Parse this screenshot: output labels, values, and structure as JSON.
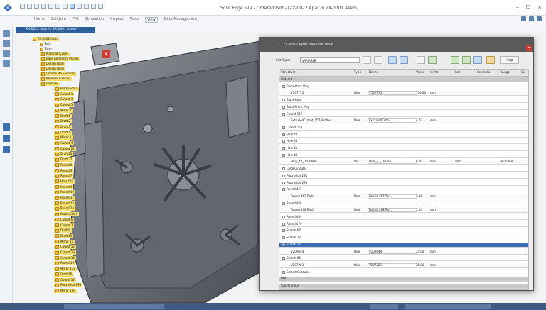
{
  "app": {
    "title": "Solid Edge ST9 - Ordered Part - [ZX-0022 Apar in ZX-0001 Asem]",
    "window_controls": [
      "–",
      "☐",
      "×"
    ]
  },
  "ribbon": {
    "tabs": [
      "Home",
      "Solidsim",
      "PMI",
      "Simulation",
      "Inspect",
      "Tools",
      "View",
      "Data Management"
    ],
    "selected_tab": "View"
  },
  "document_tab": {
    "label": "ZX-0022 Apar in ZX-0001 Asem *"
  },
  "pathfinder": {
    "items": [
      {
        "label": "ZX-0022 Apar1",
        "kind": "top"
      },
      {
        "label": "Sets",
        "kind": "node"
      },
      {
        "label": "Base",
        "kind": "node"
      },
      {
        "label": "Material (Cube)",
        "kind": "feat"
      },
      {
        "label": "Base Reference Planes",
        "kind": "feat"
      },
      {
        "label": "Design Body",
        "kind": "feat"
      },
      {
        "label": "Design Body",
        "kind": "feat"
      },
      {
        "label": "Coordinate Systems",
        "kind": "feat"
      },
      {
        "label": "Reference Planes",
        "kind": "feat"
      },
      {
        "label": "Features",
        "kind": "feat"
      },
      {
        "label": "Protrusion 1",
        "kind": "feat"
      },
      {
        "label": "Cutout 1",
        "kind": "feat"
      },
      {
        "label": "Cutout 2",
        "kind": "feat"
      },
      {
        "label": "Cutout 3",
        "kind": "feat"
      },
      {
        "label": "Mirror 1",
        "kind": "feat"
      },
      {
        "label": "Draft 1",
        "kind": "feat"
      },
      {
        "label": "Draft 2",
        "kind": "feat"
      },
      {
        "label": "Draft 3",
        "kind": "feat"
      },
      {
        "label": "Draft 4",
        "kind": "feat"
      },
      {
        "label": "Mirror 2",
        "kind": "feat"
      },
      {
        "label": "Cutout 4",
        "kind": "feat"
      },
      {
        "label": "Cutout 21",
        "kind": "feat"
      },
      {
        "label": "Draft 26",
        "kind": "feat"
      },
      {
        "label": "Draft 27",
        "kind": "feat"
      },
      {
        "label": "Round 6",
        "kind": "feat"
      },
      {
        "label": "Round 6",
        "kind": "feat"
      },
      {
        "label": "Round 7",
        "kind": "feat"
      },
      {
        "label": "Hole 403",
        "kind": "feat"
      },
      {
        "label": "Round 9",
        "kind": "feat"
      },
      {
        "label": "Round 10",
        "kind": "feat"
      },
      {
        "label": "Round 11",
        "kind": "feat"
      },
      {
        "label": "Round 12",
        "kind": "feat"
      },
      {
        "label": "Round 13",
        "kind": "feat"
      },
      {
        "label": "Protrusion 4",
        "kind": "feat"
      },
      {
        "label": "Cutout 6",
        "kind": "feat"
      },
      {
        "label": "Cutout 7",
        "kind": "feat"
      },
      {
        "label": "Draft 9",
        "kind": "feat"
      },
      {
        "label": "Draft 10",
        "kind": "feat"
      },
      {
        "label": "Mirror 11",
        "kind": "feat"
      },
      {
        "label": "Cutout 12",
        "kind": "feat"
      },
      {
        "label": "Cutout 13",
        "kind": "feat"
      },
      {
        "label": "Cutout 14",
        "kind": "feat"
      },
      {
        "label": "Round 15",
        "kind": "feat"
      },
      {
        "label": "Mirror 135",
        "kind": "feat"
      },
      {
        "label": "Draft 16",
        "kind": "feat"
      },
      {
        "label": "Cutout 17",
        "kind": "feat"
      },
      {
        "label": "Protrusion 194",
        "kind": "feat"
      },
      {
        "label": "Mirror 110",
        "kind": "feat"
      }
    ]
  },
  "variable_table": {
    "title": "ZX-0022 Apar Variable Table",
    "close_glyph": "×",
    "filter_label": "Edit Types",
    "filter_value": "VARIABLE",
    "help_label": "Help",
    "columns": [
      "Structure",
      "Type",
      "Name",
      "Value",
      "Units",
      "Rule",
      "Formula",
      "Range",
      "Ex"
    ],
    "rows": [
      {
        "kind": "sec",
        "structure": "Ordered",
        "type": "",
        "name": "",
        "value": "",
        "units": "",
        "rule": "",
        "range": ""
      },
      {
        "kind": "node",
        "structure": "Block-Back Plug",
        "type": "",
        "name": "",
        "value": "",
        "units": "",
        "rule": "",
        "range": ""
      },
      {
        "kind": "var",
        "structure": "V167775",
        "type": "Dim",
        "name": "V167775",
        "value": "130.00",
        "units": "mm",
        "rule": "",
        "range": ""
      },
      {
        "kind": "node",
        "structure": "Block-Reat",
        "type": "",
        "name": "",
        "value": "",
        "units": "",
        "rule": "",
        "range": ""
      },
      {
        "kind": "node",
        "structure": "Block-Front Plug",
        "type": "",
        "name": "",
        "value": "",
        "units": "",
        "rule": "",
        "range": ""
      },
      {
        "kind": "node",
        "structure": "Cutout 157",
        "type": "",
        "name": "",
        "value": "",
        "units": "",
        "rule": "",
        "range": ""
      },
      {
        "kind": "var",
        "structure": "ExtrudedCutout_157_Profile...",
        "type": "Dim",
        "name": "ExtrudedCutou...",
        "value": "4.42",
        "units": "mm",
        "rule": "",
        "range": ""
      },
      {
        "kind": "node",
        "structure": "Cutout 150",
        "type": "",
        "name": "",
        "value": "",
        "units": "",
        "rule": "",
        "range": ""
      },
      {
        "kind": "node",
        "structure": "Hole 44",
        "type": "",
        "name": "",
        "value": "",
        "units": "",
        "rule": "",
        "range": ""
      },
      {
        "kind": "node",
        "structure": "Hole 41",
        "type": "",
        "name": "",
        "value": "",
        "units": "",
        "rule": "",
        "range": ""
      },
      {
        "kind": "node",
        "structure": "Hole 45",
        "type": "",
        "name": "",
        "value": "",
        "units": "",
        "rule": "",
        "range": ""
      },
      {
        "kind": "node",
        "structure": "Hole 43",
        "type": "",
        "name": "",
        "value": "",
        "units": "",
        "rule": "",
        "range": ""
      },
      {
        "kind": "var",
        "structure": "Hole_43_Diameter",
        "type": "Var",
        "name": "Hole_43_Diame...",
        "value": "6.00",
        "units": "mm",
        "rule": "Limit",
        "range": "[6.00 mm..."
      },
      {
        "kind": "node",
        "structure": "LargeCutouts",
        "type": "",
        "name": "",
        "value": "",
        "units": "",
        "rule": "",
        "range": ""
      },
      {
        "kind": "node",
        "structure": "Protrusion 294",
        "type": "",
        "name": "",
        "value": "",
        "units": "",
        "rule": "",
        "range": ""
      },
      {
        "kind": "node",
        "structure": "Protrusion 296",
        "type": "",
        "name": "",
        "value": "",
        "units": "",
        "rule": "",
        "range": ""
      },
      {
        "kind": "node",
        "structure": "Round 467",
        "type": "",
        "name": "",
        "value": "",
        "units": "",
        "rule": "",
        "range": ""
      },
      {
        "kind": "var",
        "structure": "Round 467 Radii",
        "type": "Dim",
        "name": "Round 467 Ra...",
        "value": "2.00",
        "units": "mm",
        "rule": "",
        "range": ""
      },
      {
        "kind": "node",
        "structure": "Round 468",
        "type": "",
        "name": "",
        "value": "",
        "units": "",
        "rule": "",
        "range": ""
      },
      {
        "kind": "var",
        "structure": "Round 468 Radii",
        "type": "Dim",
        "name": "Round 468 Ra...",
        "value": "2.00",
        "units": "mm",
        "rule": "",
        "range": ""
      },
      {
        "kind": "node",
        "structure": "Round 469",
        "type": "",
        "name": "",
        "value": "",
        "units": "",
        "rule": "",
        "range": ""
      },
      {
        "kind": "node",
        "structure": "Round 470",
        "type": "",
        "name": "",
        "value": "",
        "units": "",
        "rule": "",
        "range": ""
      },
      {
        "kind": "node",
        "structure": "Sketch 67",
        "type": "",
        "name": "",
        "value": "",
        "units": "",
        "rule": "",
        "range": ""
      },
      {
        "kind": "node",
        "structure": "Sketch 73",
        "type": "",
        "name": "",
        "value": "",
        "units": "",
        "rule": "",
        "range": ""
      },
      {
        "kind": "hl",
        "structure": "Sketch 72",
        "type": "",
        "name": "",
        "value": "",
        "units": "",
        "rule": "",
        "range": ""
      },
      {
        "kind": "var",
        "structure": "V209644",
        "type": "Dim",
        "name": "V209644",
        "value": "25.00",
        "units": "mm",
        "rule": "",
        "range": ""
      },
      {
        "kind": "node",
        "structure": "Sketch 84",
        "type": "",
        "name": "",
        "value": "",
        "units": "",
        "rule": "",
        "range": ""
      },
      {
        "kind": "var",
        "structure": "V207203",
        "type": "Dim",
        "name": "V207203",
        "value": "25.00",
        "units": "mm",
        "rule": "",
        "range": ""
      },
      {
        "kind": "node",
        "structure": "SmoothCutouts",
        "type": "",
        "name": "",
        "value": "",
        "units": "",
        "rule": "",
        "range": ""
      },
      {
        "kind": "sec",
        "structure": "PMI",
        "type": "",
        "name": "",
        "value": "",
        "units": "",
        "rule": "",
        "range": ""
      },
      {
        "kind": "sec",
        "structure": "Synchronous",
        "type": "",
        "name": "",
        "value": "",
        "units": "",
        "rule": "",
        "range": ""
      }
    ]
  },
  "colors": {
    "feature_yellow": "#f3de6c",
    "dialog_title": "#5a5a5a",
    "selection_blue": "#3a6db3",
    "close_red": "#d03a2e"
  }
}
